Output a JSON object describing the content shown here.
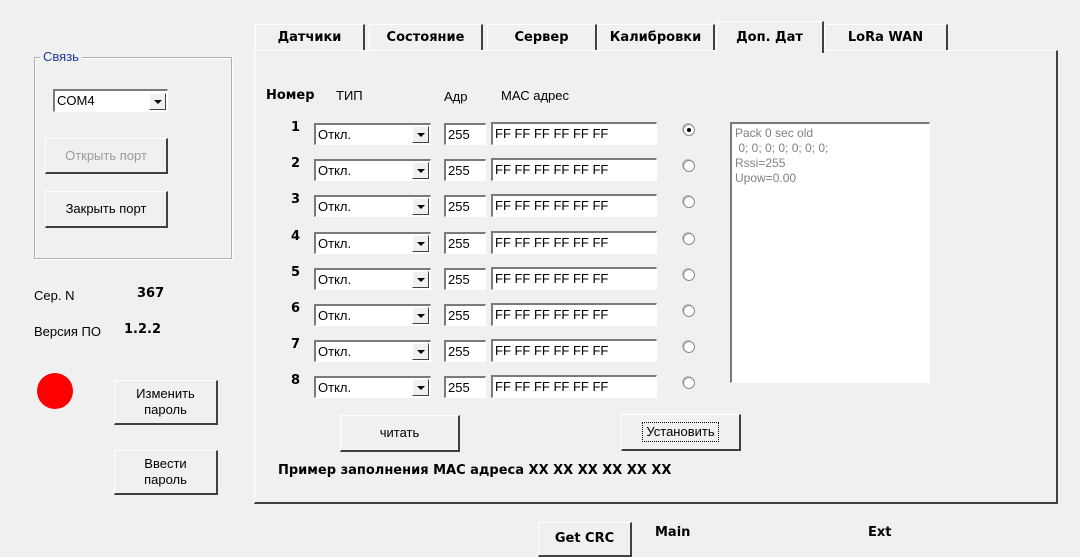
{
  "connection": {
    "group_title": "Связь",
    "port_value": "COM4",
    "open_port_label": "Открыть порт",
    "close_port_label": "Закрыть порт"
  },
  "device": {
    "serial_label": "Сер. N",
    "serial_value": "367",
    "firmware_label": "Версия ПО",
    "firmware_value": "1.2.2",
    "status_led_color": "#ff0000"
  },
  "password": {
    "change_label_line1": "Изменить",
    "change_label_line2": "пароль",
    "enter_label_line1": "Ввести",
    "enter_label_line2": "пароль"
  },
  "tabs": [
    {
      "label": "Датчики",
      "active": false
    },
    {
      "label": "Состояние",
      "active": false
    },
    {
      "label": "Сервер",
      "active": false
    },
    {
      "label": "Калибровки",
      "active": false
    },
    {
      "label": "Доп. Дат",
      "active": true
    },
    {
      "label": "LoRa WAN",
      "active": false
    }
  ],
  "sensors": {
    "headers": {
      "number": "Номер",
      "type": "ТИП",
      "addr": "Адр",
      "mac": "МАС адрес"
    },
    "rows": [
      {
        "num": "1",
        "type": "Откл.",
        "addr": "255",
        "mac": "FF FF FF FF FF FF",
        "selected": true
      },
      {
        "num": "2",
        "type": "Откл.",
        "addr": "255",
        "mac": "FF FF FF FF FF FF",
        "selected": false
      },
      {
        "num": "3",
        "type": "Откл.",
        "addr": "255",
        "mac": "FF FF FF FF FF FF",
        "selected": false
      },
      {
        "num": "4",
        "type": "Откл.",
        "addr": "255",
        "mac": "FF FF FF FF FF FF",
        "selected": false
      },
      {
        "num": "5",
        "type": "Откл.",
        "addr": "255",
        "mac": "FF FF FF FF FF FF",
        "selected": false
      },
      {
        "num": "6",
        "type": "Откл.",
        "addr": "255",
        "mac": "FF FF FF FF FF FF",
        "selected": false
      },
      {
        "num": "7",
        "type": "Откл.",
        "addr": "255",
        "mac": "FF FF FF FF FF FF",
        "selected": false
      },
      {
        "num": "8",
        "type": "Откл.",
        "addr": "255",
        "mac": "FF FF FF FF FF FF",
        "selected": false
      }
    ],
    "info_text": "Pack 0 sec old\n 0; 0; 0; 0; 0; 0; 0;\nRssi=255\nUpow=0.00",
    "read_label": "читать",
    "set_label": "Установить",
    "mac_example": "Пример заполнения МАС адреса XX XX XX XX XX XX"
  },
  "footer": {
    "crc_label": "Get CRC",
    "main_label": "Main",
    "ext_label": "Ext"
  }
}
